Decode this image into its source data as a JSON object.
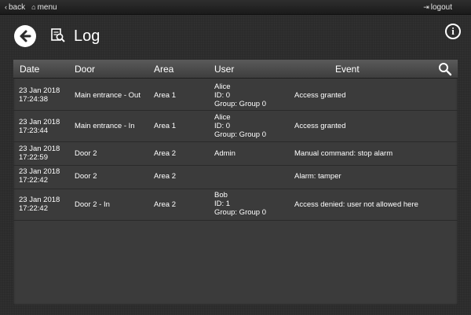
{
  "topbar": {
    "back_label": "back",
    "menu_label": "menu",
    "logout_label": "logout"
  },
  "header": {
    "title": "Log",
    "back_icon": "arrow-left-circle",
    "page_icon": "log-search-icon",
    "info_icon": "info-circle",
    "info_glyph": "i"
  },
  "table": {
    "columns": [
      "Date",
      "Door",
      "Area",
      "User",
      "Event"
    ],
    "search_icon": "magnifier",
    "rows": [
      {
        "date": "23 Jan 2018\n17:24:38",
        "door": "Main entrance - Out",
        "area": "Area 1",
        "user": "Alice\nID: 0\nGroup: Group 0",
        "event": "Access granted"
      },
      {
        "date": "23 Jan 2018\n17:23:44",
        "door": "Main entrance - In",
        "area": "Area 1",
        "user": "Alice\nID: 0\nGroup: Group 0",
        "event": "Access granted"
      },
      {
        "date": "23 Jan 2018\n17:22:59",
        "door": "Door 2",
        "area": "Area 2",
        "user": "Admin",
        "event": "Manual command: stop alarm"
      },
      {
        "date": "23 Jan 2018\n17:22:42",
        "door": "Door 2",
        "area": "Area 2",
        "user": "",
        "event": "Alarm: tamper"
      },
      {
        "date": "23 Jan 2018\n17:22:42",
        "door": "Door 2 - In",
        "area": "Area 2",
        "user": "Bob\nID: 1\nGroup: Group 0",
        "event": "Access denied: user not allowed here"
      }
    ]
  }
}
